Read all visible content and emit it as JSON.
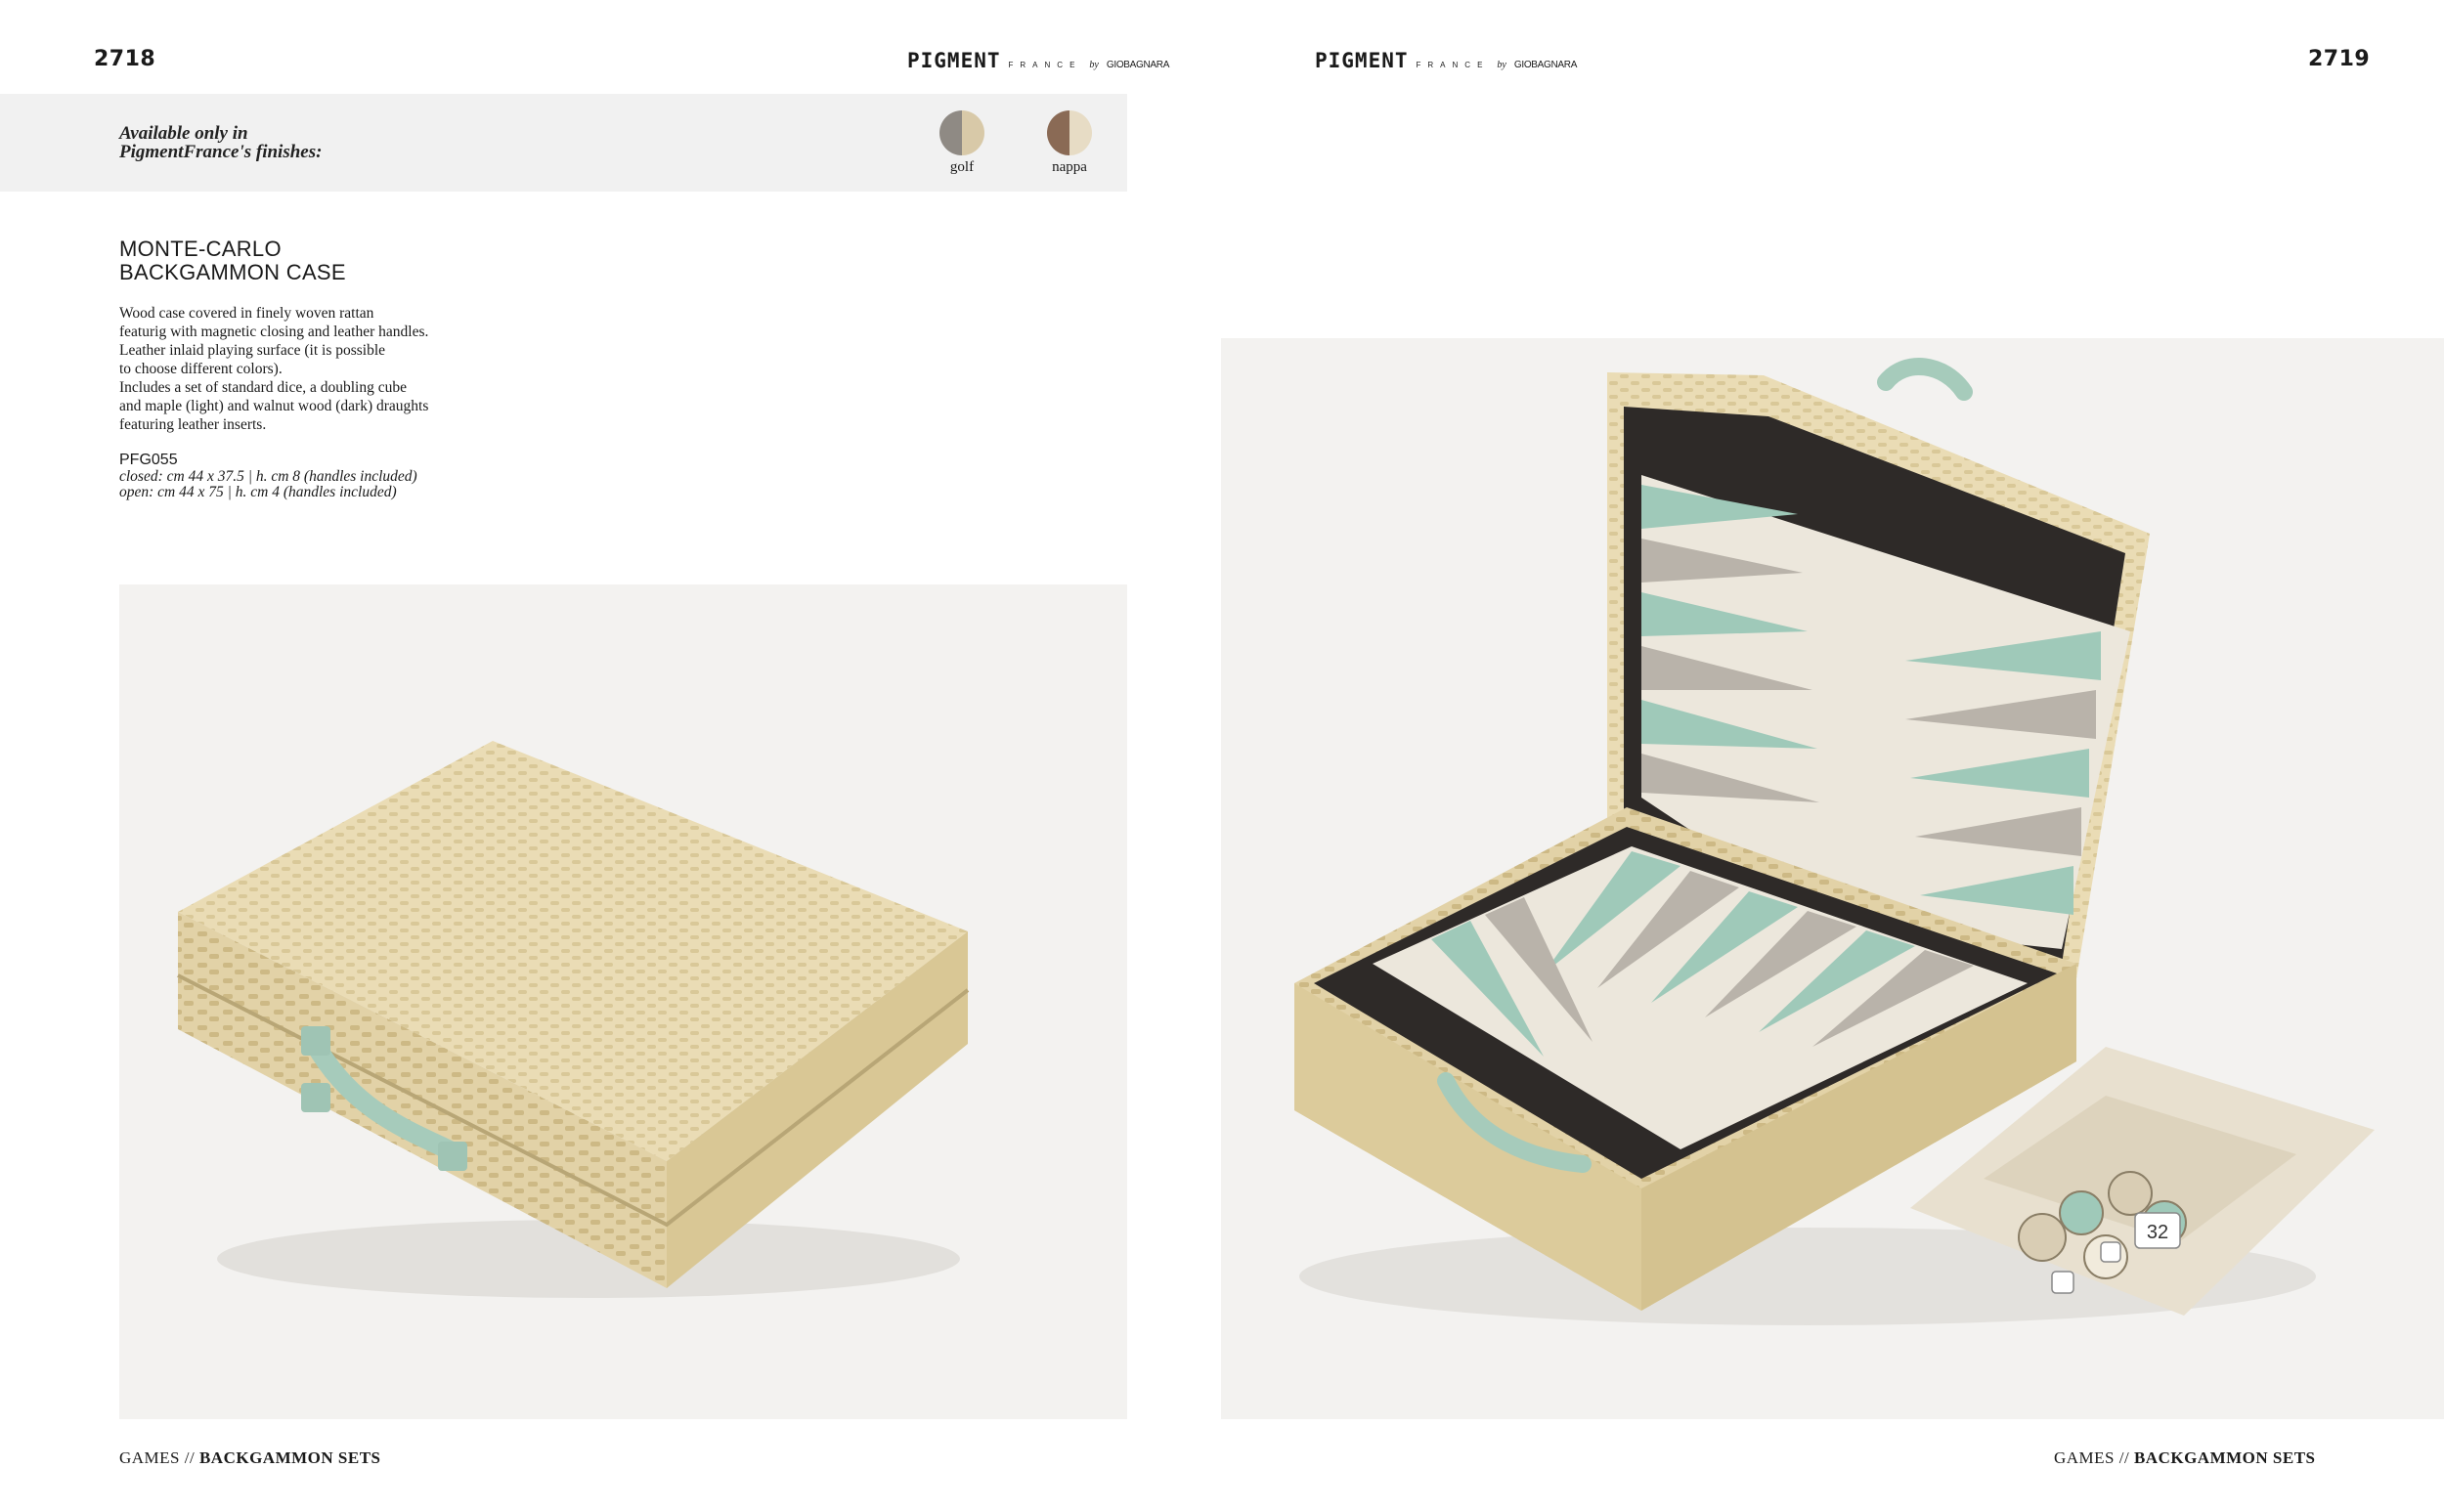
{
  "left_page": {
    "page_number": "2718",
    "brand": {
      "name": "PIGMENT",
      "sub": "FRANCE",
      "by": "by",
      "maker": "GIOBAGNARA"
    },
    "finishes": {
      "intro_line1": "Available only in",
      "intro_line2": "PigmentFrance's finishes:",
      "items": [
        {
          "label": "golf",
          "color_left": "#8f8a84",
          "color_right": "#d8c9a8"
        },
        {
          "label": "nappa",
          "color_left": "#8a6a55",
          "color_right": "#e7dcc5"
        }
      ]
    },
    "product": {
      "title_line1": "MONTE-CARLO",
      "title_line2": "BACKGAMMON CASE",
      "description": [
        "Wood case covered in finely woven rattan",
        "featurig with magnetic closing and leather handles.",
        "Leather inlaid playing surface (it is possible",
        "to choose different colors).",
        "Includes a set of standard dice, a doubling cube",
        "and maple (light) and walnut wood (dark) draughts",
        "featuring leather inserts."
      ],
      "code": "PFG055",
      "closed": "closed: cm 44 x 37.5 | h. cm 8 (handles included)",
      "open": "open: cm 44 x 75 | h. cm 4 (handles included)"
    },
    "footer": {
      "category": "GAMES //",
      "subcategory": "BACKGAMMON SETS"
    }
  },
  "right_page": {
    "page_number": "2719",
    "brand": {
      "name": "PIGMENT",
      "sub": "FRANCE",
      "by": "by",
      "maker": "GIOBAGNARA"
    },
    "doubling_cube_value": "32",
    "footer": {
      "category": "GAMES //",
      "subcategory": "BACKGAMMON SETS"
    }
  },
  "colors": {
    "rattan": "#e9dcb8",
    "rattan_shade": "#d8c79c",
    "mint": "#9fc9b9",
    "taupe": "#b9b3aa",
    "board_bg": "#ece7dc",
    "velvet": "#2e2a28"
  }
}
